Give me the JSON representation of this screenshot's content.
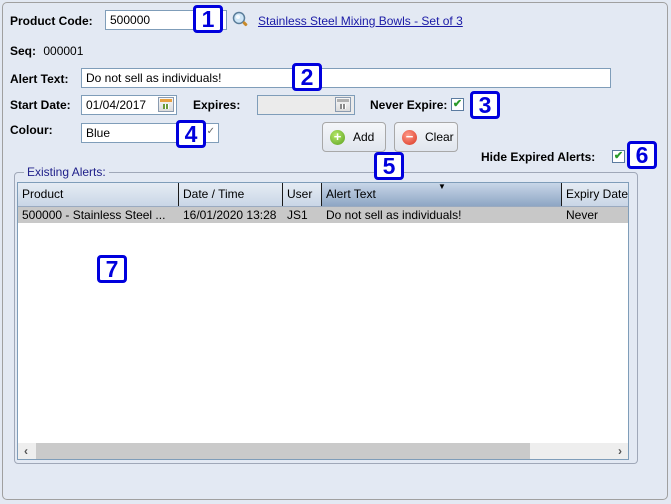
{
  "form": {
    "product_code_label": "Product Code:",
    "product_code_value": "500000",
    "product_link": "Stainless Steel Mixing Bowls - Set of 3",
    "seq_label": "Seq:",
    "seq_value": "000001",
    "alert_text_label": "Alert Text:",
    "alert_text_value": "Do not sell as individuals!",
    "start_date_label": "Start Date:",
    "start_date_value": "01/04/2017",
    "expires_label": "Expires:",
    "expires_value": "",
    "never_expire_label": "Never Expire:",
    "never_expire_checked": true,
    "colour_label": "Colour:",
    "colour_value": "Blue",
    "hide_expired_label": "Hide Expired Alerts:",
    "hide_expired_checked": true
  },
  "buttons": {
    "add_label": "Add",
    "clear_label": "Clear"
  },
  "icons": {
    "check": "✔",
    "plus": "+",
    "minus": "−",
    "sort_desc": "▼",
    "scroll_left": "‹",
    "scroll_right": "›"
  },
  "alerts_group": {
    "title": "Existing Alerts:",
    "columns": [
      "Product",
      "Date / Time",
      "User",
      "Alert Text",
      "Expiry Date"
    ],
    "sorted_column": "Alert Text",
    "rows": [
      {
        "product": "500000 - Stainless Steel ...",
        "date_time": "16/01/2020 13:28",
        "user": "JS1",
        "alert_text": "Do not sell as individuals!",
        "expiry_date": "Never"
      }
    ]
  },
  "annotations": [
    "1",
    "2",
    "3",
    "4",
    "5",
    "6",
    "7"
  ],
  "colors": {
    "background": "#e3e9f3",
    "annotation_blue": "#0000dd",
    "link": "#1a1aa6",
    "selected_row": "#c8c8c8"
  }
}
